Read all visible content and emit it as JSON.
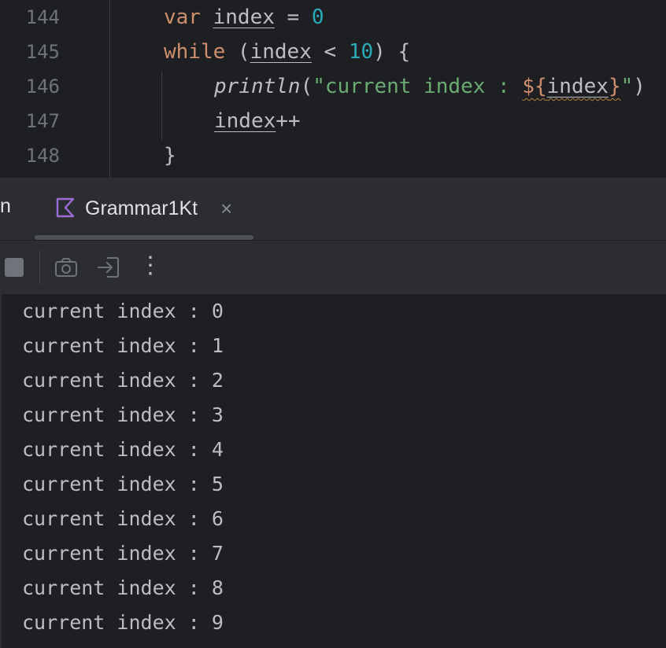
{
  "editor": {
    "lines": [
      {
        "num": "144"
      },
      {
        "num": "145"
      },
      {
        "num": "146"
      },
      {
        "num": "147"
      },
      {
        "num": "148"
      }
    ],
    "code": {
      "l144": {
        "kw": "var",
        "name": "index",
        "op": " = ",
        "value": "0"
      },
      "l145": {
        "kw": "while",
        "open": " (",
        "name": "index",
        "op": " < ",
        "value": "10",
        "close": ") {"
      },
      "l146": {
        "fn": "println",
        "open": "(",
        "str1": "\"current index : ",
        "tpl_open": "${",
        "name": "index",
        "tpl_close": "}",
        "str2": "\"",
        "close": ")"
      },
      "l147": {
        "name": "index",
        "op": "++"
      },
      "l148": {
        "brace": "}"
      }
    }
  },
  "tabbar": {
    "cut_label": "n",
    "tab_label": "Grammar1Kt",
    "close_glyph": "×"
  },
  "toolbar": {
    "icons": [
      "stop-icon",
      "camera-icon",
      "exit-icon",
      "more-icon"
    ],
    "more_glyph": "⋮"
  },
  "console": {
    "lines": [
      "current index : 0",
      "current index : 1",
      "current index : 2",
      "current index : 3",
      "current index : 4",
      "current index : 5",
      "current index : 6",
      "current index : 7",
      "current index : 8",
      "current index : 9"
    ]
  },
  "colors": {
    "background": "#1e1f22",
    "panel": "#2b2d30",
    "keyword": "#cf8e6d",
    "number": "#2aacb8",
    "string": "#6aab73",
    "text": "#bcbec4",
    "kotlin_icon": "#9b6bd8"
  }
}
